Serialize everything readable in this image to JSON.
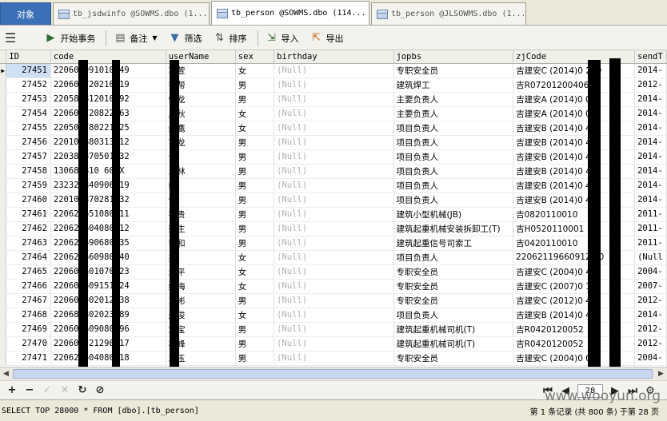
{
  "tabs": [
    {
      "label": "对象",
      "active": false
    },
    {
      "label": "tb_jsdwinfo @SOWMS.dbo (1...",
      "active": false
    },
    {
      "label": "tb_person @SOWMS.dbo (114...",
      "active": true
    },
    {
      "label": "tb_person @JLSOWMS.dbo (1...",
      "active": false
    }
  ],
  "toolbar": {
    "menu_icon": "hamburger-icon",
    "begin_transaction": "开始事务",
    "memo": "备注",
    "filter": "筛选",
    "sort": "排序",
    "import": "导入",
    "export": "导出"
  },
  "columns": [
    "ID",
    "code",
    "userName",
    "sex",
    "birthday",
    "jopbs",
    "zjCode",
    "sendT"
  ],
  "rows": [
    {
      "id": "27451",
      "code": "220601991010349",
      "name": "茗萱",
      "sex": "女",
      "birthday": "(Null)",
      "jopbs": "专职安全员",
      "zj": "吉建安C (2014)0 279",
      "send": "2014-"
    },
    {
      "id": "27452",
      "code": "220609720210919",
      "name": "振帮",
      "sex": "男",
      "birthday": "(Null)",
      "jopbs": "建筑焊工",
      "zj": "吉R07201200406",
      "send": "2012-"
    },
    {
      "id": "27453",
      "code": "220588812010192",
      "name": "恒龙",
      "sex": "男",
      "birthday": "(Null)",
      "jopbs": "主要负责人",
      "zj": "吉建安A (2014)0 07",
      "send": "2014-"
    },
    {
      "id": "27454",
      "code": "220609720822563",
      "name": "彦秋",
      "sex": "女",
      "birthday": "(Null)",
      "jopbs": "主要负责人",
      "zj": "吉建安A (2014)0 07",
      "send": "2014-"
    },
    {
      "id": "27455",
      "code": "220509780221025",
      "name": "红鹰",
      "sex": "女",
      "birthday": "(Null)",
      "jopbs": "项目负责人",
      "zj": "吉建安B (2014)0 47",
      "send": "2014-"
    },
    {
      "id": "27456",
      "code": "220108880313312",
      "name": "飞龙",
      "sex": "男",
      "birthday": "(Null)",
      "jopbs": "项目负责人",
      "zj": "吉建安B (2014)0 47",
      "send": "2014-"
    },
    {
      "id": "27457",
      "code": "220387870501032",
      "name": "浩",
      "sex": "男",
      "birthday": "(Null)",
      "jopbs": "项目负责人",
      "zj": "吉建安B (2014)0 47",
      "send": "2014-"
    },
    {
      "id": "27458",
      "code": "130688810 605X",
      "name": "二林",
      "sex": "男",
      "birthday": "(Null)",
      "jopbs": "项目负责人",
      "zj": "吉建安B (2014)0 47",
      "send": "2014-"
    },
    {
      "id": "27459",
      "code": "232329840906719",
      "name": "朝",
      "sex": "男",
      "birthday": "(Null)",
      "jopbs": "项目负责人",
      "zj": "吉建安B (2014)0 47",
      "send": "2014-"
    },
    {
      "id": "27460",
      "code": "220109870281032",
      "name": "健",
      "sex": "男",
      "birthday": "(Null)",
      "jopbs": "项目负责人",
      "zj": "吉建安B (2014)0 47",
      "send": "2014-"
    },
    {
      "id": "27461",
      "code": "220628651080711",
      "name": "福贵",
      "sex": "男",
      "birthday": "(Null)",
      "jopbs": "建筑小型机械(JB)",
      "zj": "吉0820110010",
      "send": "2011-"
    },
    {
      "id": "27462",
      "code": "220628604080712",
      "name": "荣生",
      "sex": "男",
      "birthday": "(Null)",
      "jopbs": "建筑起重机械安装拆卸工(T)",
      "zj": "吉H0520110001",
      "send": "2011-"
    },
    {
      "id": "27463",
      "code": "220628690680735",
      "name": "守和",
      "sex": "男",
      "birthday": "(Null)",
      "jopbs": "建筑起重信号司索工",
      "zj": "吉0420110010",
      "send": "2011-"
    },
    {
      "id": "27464",
      "code": "220628660980540",
      "name": "杰",
      "sex": "女",
      "birthday": "(Null)",
      "jopbs": "项目负责人",
      "zj": "22062119660912 40",
      "send": "(Null"
    },
    {
      "id": "27465",
      "code": "220608601070323",
      "name": "淑平",
      "sex": "女",
      "birthday": "(Null)",
      "jopbs": "专职安全员",
      "zj": "吉建安C (2004)0 40",
      "send": "2004-"
    },
    {
      "id": "27466",
      "code": "220607609151224",
      "name": "红梅",
      "sex": "女",
      "birthday": "(Null)",
      "jopbs": "专职安全员",
      "zj": "吉建安C (2007)0 13",
      "send": "2007-"
    },
    {
      "id": "27467",
      "code": "220607402012438",
      "name": "玉彬",
      "sex": "男",
      "birthday": "(Null)",
      "jopbs": "专职安全员",
      "zj": "吉建安C (2012)0 47",
      "send": "2012-"
    },
    {
      "id": "27468",
      "code": "220687802023489",
      "name": "连俊",
      "sex": "女",
      "birthday": "(Null)",
      "jopbs": "项目负责人",
      "zj": "吉建安B (2014)0 47",
      "send": "2014-"
    },
    {
      "id": "27469",
      "code": "220608609080296",
      "name": "宜宝",
      "sex": "男",
      "birthday": "(Null)",
      "jopbs": "建筑起重机械司机(T)",
      "zj": "吉R0420120052",
      "send": "2012-"
    },
    {
      "id": "27470",
      "code": "220609721290917",
      "name": "林峰",
      "sex": "男",
      "birthday": "(Null)",
      "jopbs": "建筑起重机械司机(T)",
      "zj": "吉R0420120052",
      "send": "2012-"
    },
    {
      "id": "27471",
      "code": "220628604080018",
      "name": "承玉",
      "sex": "男",
      "birthday": "(Null)",
      "jopbs": "专职安全员",
      "zj": "吉建安C (2004)0 02",
      "send": "2004-"
    }
  ],
  "nav": {
    "add": "+",
    "remove": "−",
    "apply": "✓",
    "cancel": "✕",
    "refresh": "↻",
    "stop": "⊘",
    "page_value": "28"
  },
  "status": {
    "sql": "SELECT TOP 28000  * FROM [dbo].[tb_person]",
    "record_info": "第 1 条记录 (共 800 条) 于第 28 页"
  },
  "watermark": "www.wooyun.org",
  "colors": {
    "objects_tab": "#3b6fb6",
    "null_text": "#b0b0b0"
  }
}
